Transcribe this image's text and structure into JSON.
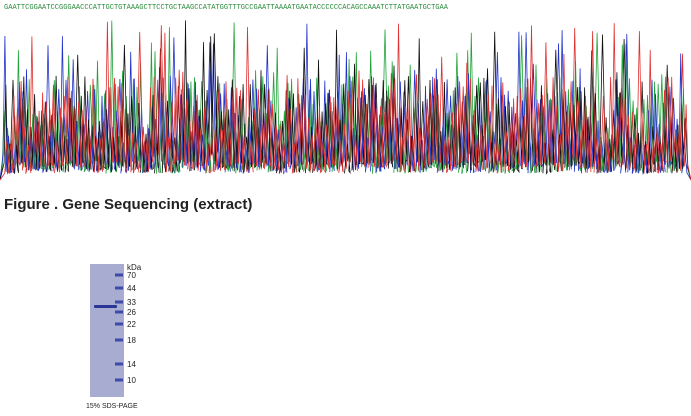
{
  "sequencing": {
    "base_calls": "GAATTCGGAATCCGGGAACCCATTGCTGTAAAGCTTCCTGCTAAGCCATATGGTTTGCCGAATTAAAATGAATACCCCCCACAGCCAAATCTTATGAATGCTGAA",
    "base_colors": {
      "A": "#22a33a",
      "C": "#2233cc",
      "G": "#111111",
      "T": "#e03030"
    },
    "caption": "Figure . Gene Sequencing (extract)"
  },
  "gel": {
    "unit_label": "kDa",
    "markers": [
      "70",
      "44",
      "33",
      "26",
      "22",
      "18",
      "14",
      "10"
    ],
    "footer": "15% SDS-PAGE"
  }
}
